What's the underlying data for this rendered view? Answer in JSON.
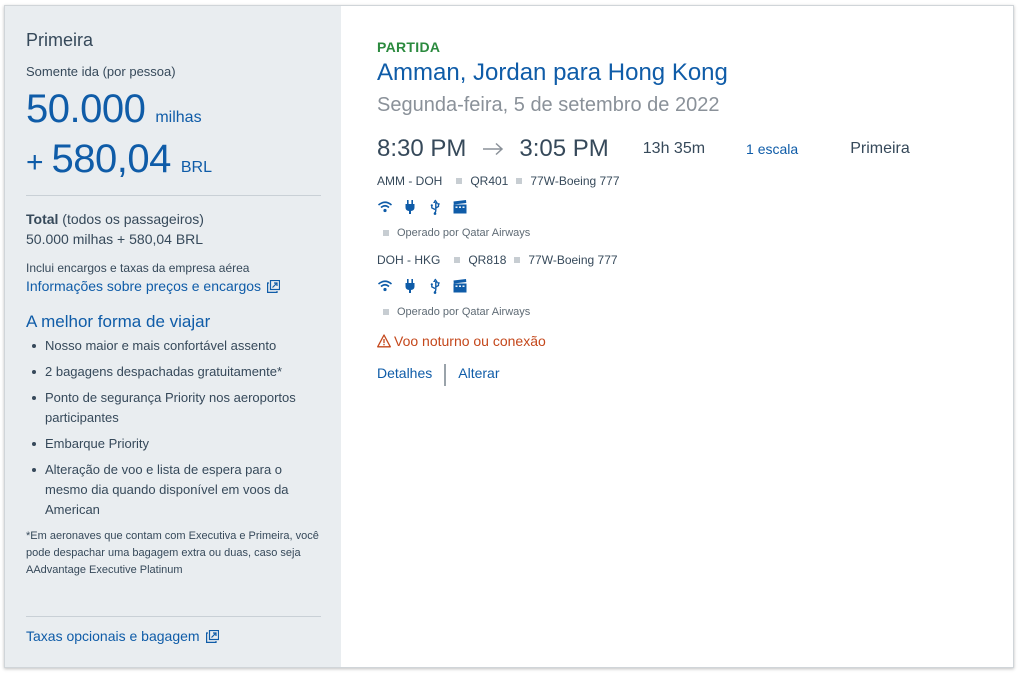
{
  "summary": {
    "cabin": "Primeira",
    "trip_type": "Somente ida (por pessoa)",
    "miles": "50.000",
    "miles_unit": "milhas",
    "plus": "+",
    "cash": "580,04",
    "currency": "BRL",
    "total_label": "Total",
    "total_suffix": " (todos os passageiros)",
    "total_value": "50.000 milhas + 580,04 BRL",
    "includes_text": "Inclui encargos e taxas da empresa aérea",
    "info_link": "Informações sobre preços e encargos",
    "best_title": "A melhor forma de viajar",
    "benefits": [
      "Nosso maior e mais confortável assento",
      "2 bagagens despachadas gratuitamente*",
      "Ponto de segurança Priority nos aeroportos participantes",
      "Embarque Priority",
      "Alteração de voo e lista de espera para o mesmo dia quando disponível em voos da American"
    ],
    "footnote": "*Em aeronaves que contam com Executiva e Primeira, você pode despachar uma bagagem extra ou duas, caso seja AAdvantage Executive Platinum",
    "optional_link": "Taxas opcionais e bagagem"
  },
  "flight": {
    "label": "PARTIDA",
    "route": "Amman, Jordan para Hong Kong",
    "date": "Segunda-feira, 5 de setembro de 2022",
    "depart_time": "8:30 PM",
    "arrive_time": "3:05 PM",
    "duration": "13h 35m",
    "stops": "1 escala",
    "cabin": "Primeira",
    "segments": [
      {
        "route": "AMM - DOH",
        "flight": "QR401",
        "aircraft": "77W-Boeing 777",
        "operated": "Operado por Qatar Airways"
      },
      {
        "route": "DOH - HKG",
        "flight": "QR818",
        "aircraft": "77W-Boeing 777",
        "operated": "Operado por Qatar Airways"
      }
    ],
    "amenity_icons": [
      "wifi-icon",
      "power-icon",
      "usb-icon",
      "entertainment-icon"
    ],
    "warning": "Voo noturno ou conexão",
    "details_link": "Detalhes",
    "change_link": "Alterar"
  },
  "colors": {
    "brand_blue": "#0f5ca8",
    "green": "#2b8a3e",
    "warning": "#c4471b",
    "panel_bg": "#e9edf0"
  }
}
